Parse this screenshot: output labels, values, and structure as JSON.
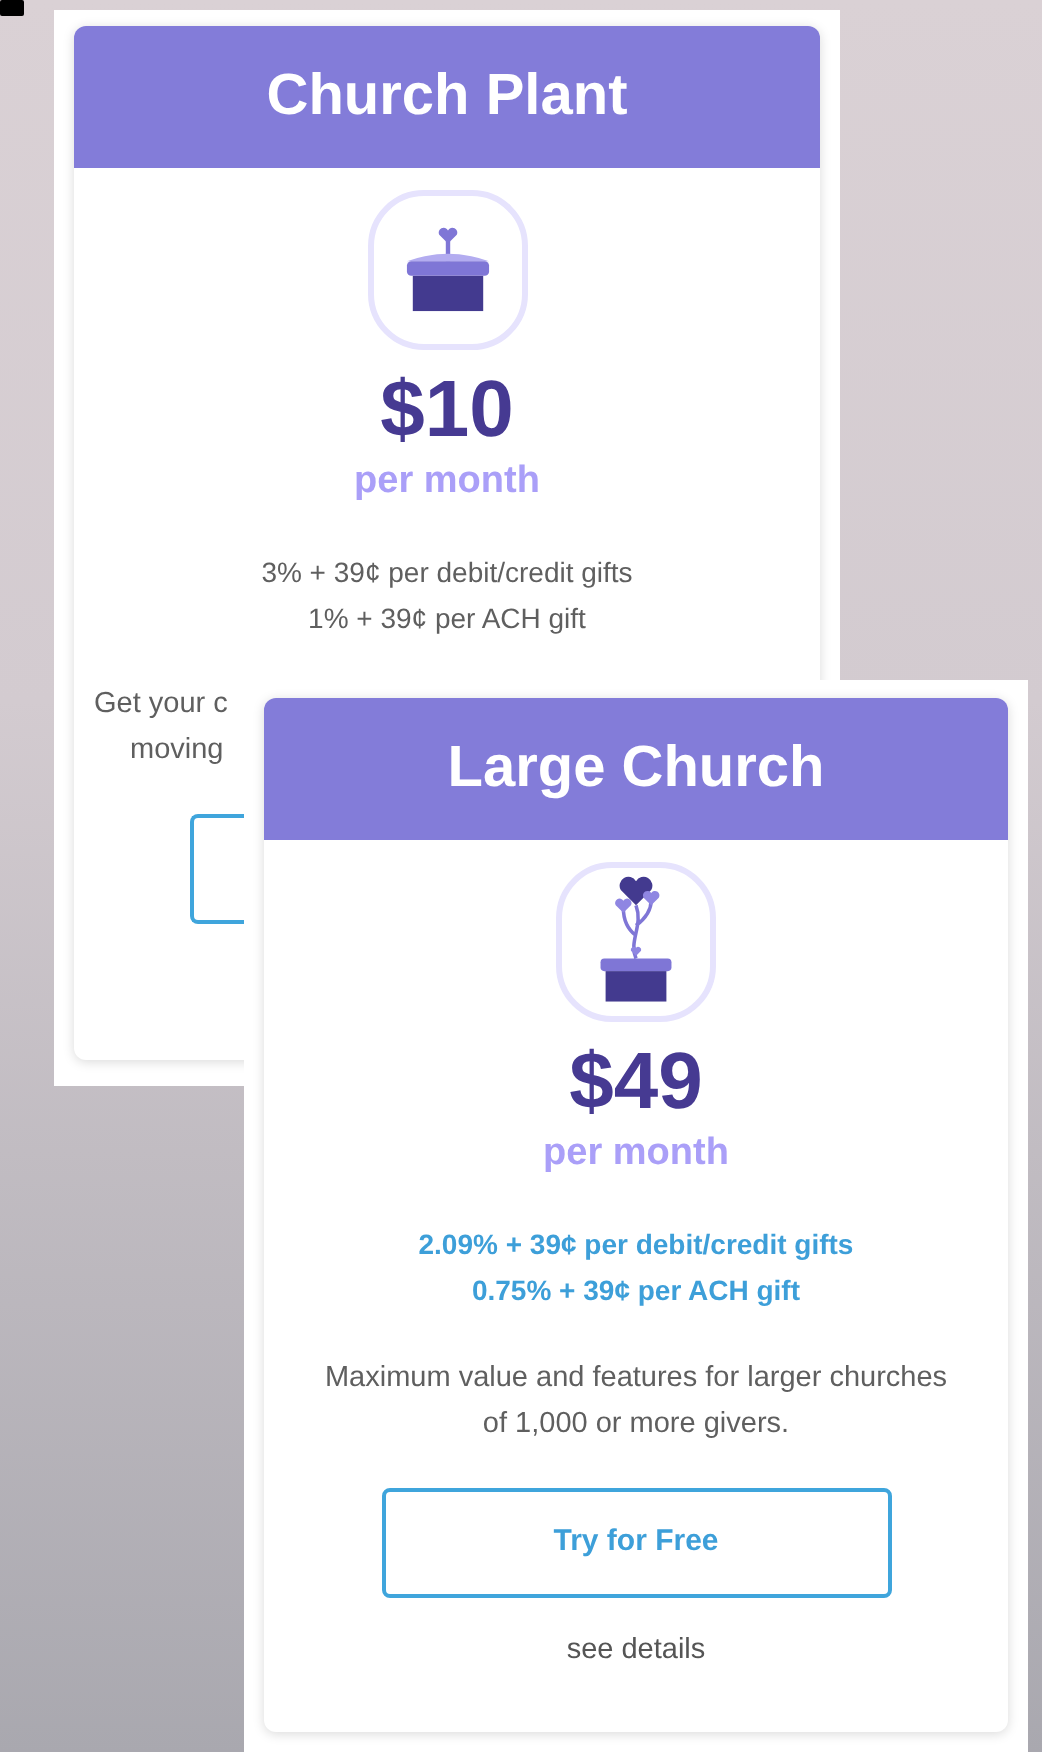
{
  "plans": [
    {
      "kind": "plant",
      "title": "Church Plant",
      "price": "$10",
      "period": "per month",
      "highlight": false,
      "fees": [
        "3% + 39¢ per debit/credit gifts",
        "1% + 39¢ per ACH gift"
      ],
      "description": [
        "Get your c",
        "moving"
      ]
    },
    {
      "kind": "tree",
      "title": "Large Church",
      "price": "$49",
      "period": "per month",
      "highlight": true,
      "fees": [
        "2.09% + 39¢ per debit/credit gifts",
        "0.75% + 39¢ per ACH gift"
      ],
      "description": [
        "Maximum value and features for larger churches",
        "of 1,000 or more givers."
      ],
      "button": "Try for Free",
      "link": "see details"
    }
  ]
}
